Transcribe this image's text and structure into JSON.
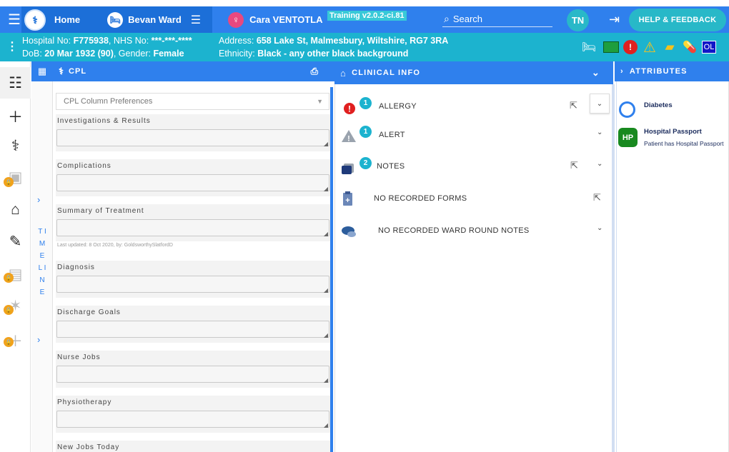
{
  "nav": {
    "home_label": "Home",
    "ward_label": "Bevan Ward",
    "patient_label": "Cara VENTOTLA",
    "training_badge": "Training v2.0.2-ci.81",
    "search_label": "Search",
    "user_initials": "TN",
    "help_label": "HELP & FEEDBACK"
  },
  "banner": {
    "hospital_label": "Hospital No: ",
    "hospital_no": "F775938",
    "nhs_label": ", NHS No: ",
    "nhs_no": "***-***-****",
    "dob_label": "DoB: ",
    "dob": "20 Mar 1932 (90)",
    "gender_label": ", Gender: ",
    "gender": "Female",
    "address_label": "Address: ",
    "address": "658 Lake St, Malmesbury, Wiltshire, RG7 3RA",
    "ethnicity_label": "Ethnicity: ",
    "ethnicity": "Black - any other black background",
    "ol_badge": "OL"
  },
  "timeline": {
    "label": "T I M E L I N E"
  },
  "cpl": {
    "title": "CPL",
    "select_value": "CPL Column Preferences",
    "sections": [
      {
        "label": "Investigations & Results"
      },
      {
        "label": "Complications"
      },
      {
        "label": "Summary of Treatment"
      },
      {
        "label": "Diagnosis"
      },
      {
        "label": "Discharge Goals"
      },
      {
        "label": "Nurse Jobs"
      },
      {
        "label": "Physiotherapy"
      },
      {
        "label": "New Jobs Today"
      }
    ],
    "last_updated": "Last updated: 8 Oct 2020, by: GoldsworthySlatfordD"
  },
  "clinical": {
    "title": "CLINICAL INFO",
    "rows": [
      {
        "label": "ALLERGY",
        "count": "1"
      },
      {
        "label": "ALERT",
        "count": "1"
      },
      {
        "label": "NOTES",
        "count": "2"
      },
      {
        "label": "NO RECORDED FORMS"
      },
      {
        "label": "NO RECORDED WARD ROUND NOTES"
      }
    ]
  },
  "attributes": {
    "title": "ATTRIBUTES",
    "items": [
      {
        "title": "Diabetes"
      },
      {
        "badge": "HP",
        "title": "Hospital Passport",
        "subtitle": "Patient has Hospital Passport"
      }
    ]
  },
  "colors": {
    "primary": "#2f80ed",
    "banner": "#1cb3cf",
    "teal": "#28b8c8",
    "lock": "#f1a21d",
    "hp_green": "#18891f"
  }
}
